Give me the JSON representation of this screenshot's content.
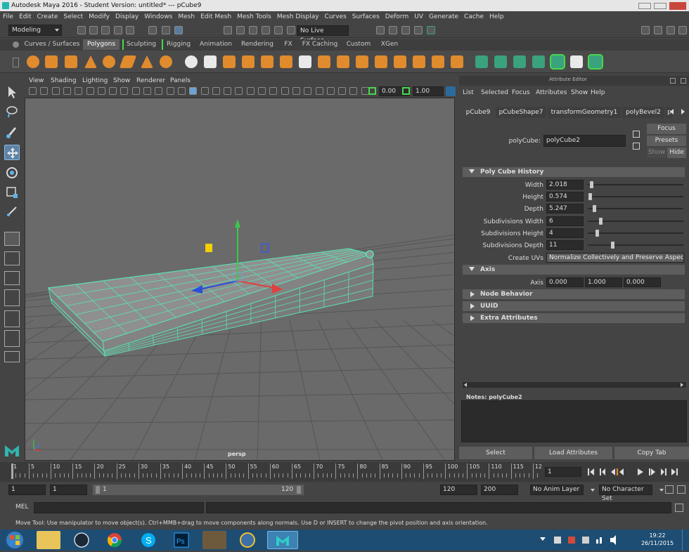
{
  "window": {
    "title": "Autodesk Maya 2016 - Student Version: untitled*   ---   pCube9"
  },
  "menubar": {
    "items": [
      "File",
      "Edit",
      "Create",
      "Select",
      "Modify",
      "Display",
      "Windows",
      "Mesh",
      "Edit Mesh",
      "Mesh Tools",
      "Mesh Display",
      "Curves",
      "Surfaces",
      "Deform",
      "UV",
      "Generate",
      "Cache",
      "Help"
    ]
  },
  "status_line": {
    "mode": "Modeling",
    "live_surface": "No Live Surface"
  },
  "shelf": {
    "tabs": [
      "Curves / Surfaces",
      "Polygons",
      "Sculpting",
      "Rigging",
      "Animation",
      "Rendering",
      "FX",
      "FX Caching",
      "Custom",
      "XGen"
    ],
    "active_tab": "Polygons"
  },
  "viewport": {
    "menus": [
      "View",
      "Shading",
      "Lighting",
      "Show",
      "Renderer",
      "Panels"
    ],
    "field_a": "0.00",
    "field_b": "1.00",
    "camera_label": "persp"
  },
  "attribute_editor": {
    "header": "Attribute Editor",
    "menus": [
      "List",
      "Selected",
      "Focus",
      "Attributes",
      "Show",
      "Help"
    ],
    "node_tabs": [
      "pCube9",
      "pCubeShape7",
      "transformGeometry1",
      "polyBevel2",
      "p"
    ],
    "node_type_label": "polyCube:",
    "node_name": "polyCube2",
    "buttons": {
      "focus": "Focus",
      "presets": "Presets",
      "show": "Show",
      "hide": "Hide"
    },
    "section_history": "Poly Cube History",
    "attributes": [
      {
        "label": "Width",
        "value": "2.018",
        "slider": 0.02
      },
      {
        "label": "Height",
        "value": "0.574",
        "slider": 0.005
      },
      {
        "label": "Depth",
        "value": "5.247",
        "slider": 0.05
      },
      {
        "label": "Subdivisions Width",
        "value": "6",
        "slider": 0.12
      },
      {
        "label": "Subdivisions Height",
        "value": "4",
        "slider": 0.08
      },
      {
        "label": "Subdivisions Depth",
        "value": "11",
        "slider": 0.24
      }
    ],
    "create_uvs_label": "Create UVs",
    "create_uvs_value": "Normalize Collectively and Preserve Aspect Ratio",
    "section_axis": "Axis",
    "axis_label": "Axis",
    "axis_values": [
      "0.000",
      "1.000",
      "0.000"
    ],
    "collapsed_sections": [
      "Node Behavior",
      "UUID",
      "Extra Attributes"
    ],
    "notes_label": "Notes:  polyCube2",
    "bottom_buttons": [
      "Select",
      "Load Attributes",
      "Copy Tab"
    ]
  },
  "timeline": {
    "ticks": [
      "1",
      "5",
      "10",
      "15",
      "20",
      "25",
      "30",
      "35",
      "40",
      "45",
      "50",
      "55",
      "60",
      "65",
      "70",
      "75",
      "80",
      "85",
      "90",
      "95",
      "100",
      "105",
      "110",
      "115",
      "12"
    ],
    "current_frame": "1"
  },
  "range": {
    "start": "1",
    "anim_start": "1",
    "bar_start": "1",
    "bar_end": "120",
    "anim_end": "120",
    "end": "200",
    "anim_layer": "No Anim Layer",
    "character_set": "No Character Set"
  },
  "command_line": {
    "label": "MEL"
  },
  "help_line": {
    "text": "Move Tool: Use manipulator to move object(s). Ctrl+MMB+drag to move components along normals. Use D or INSERT to change the pivot position and axis orientation."
  },
  "taskbar": {
    "time": "19:22",
    "date": "26/11/2015"
  },
  "colors": {
    "wireframe": "#59e2b0",
    "accent_green": "#3aa27d",
    "shelf_orange": "#e08b2d",
    "taskbar": "#1e4d73"
  }
}
